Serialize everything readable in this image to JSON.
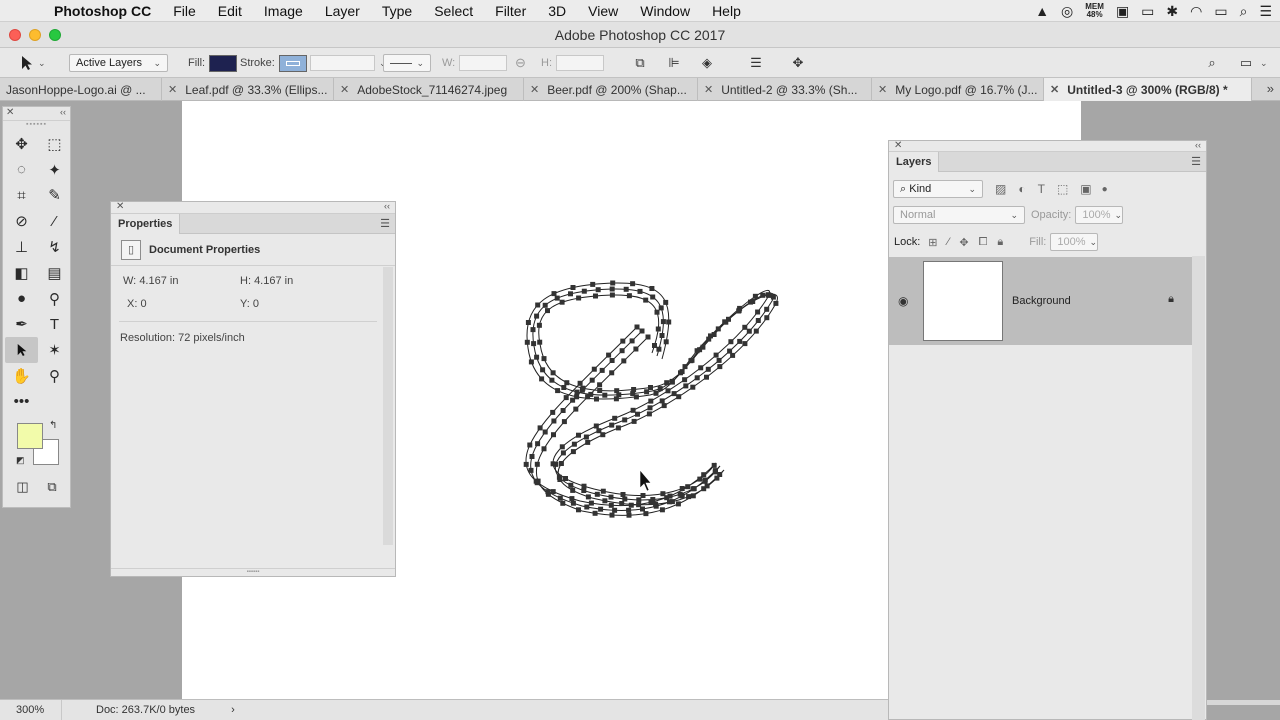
{
  "menubar": {
    "app_name": "Photoshop CC",
    "items": [
      "File",
      "Edit",
      "Image",
      "Layer",
      "Type",
      "Select",
      "Filter",
      "3D",
      "View",
      "Window",
      "Help"
    ],
    "mem_label": "MEM",
    "mem_value": "48%"
  },
  "window": {
    "title": "Adobe Photoshop CC 2017"
  },
  "options": {
    "auto_select": "Active Layers",
    "fill_label": "Fill:",
    "fill_color": "#1e2250",
    "stroke_label": "Stroke:",
    "stroke_color": "#8fb1d9",
    "w_label": "W:",
    "h_label": "H:"
  },
  "tabs": [
    {
      "label": "JasonHoppe-Logo.ai @ ...",
      "active": false
    },
    {
      "label": "Leaf.pdf @ 33.3% (Ellips...",
      "active": false
    },
    {
      "label": "AdobeStock_71146274.jpeg",
      "active": false
    },
    {
      "label": "Beer.pdf @ 200% (Shap...",
      "active": false
    },
    {
      "label": "Untitled-2 @ 33.3% (Sh...",
      "active": false
    },
    {
      "label": "My Logo.pdf @ 16.7% (J...",
      "active": false
    },
    {
      "label": "Untitled-3 @ 300% (RGB/8) *",
      "active": true
    }
  ],
  "toolbox": {
    "foreground_color": "#f2fbaa",
    "background_color": "#ffffff"
  },
  "properties": {
    "tab_label": "Properties",
    "section_title": "Document Properties",
    "w_label": "W:",
    "w_value": "4.167 in",
    "h_label": "H:",
    "h_value": "4.167 in",
    "x_label": "X:",
    "x_value": "0",
    "y_label": "Y:",
    "y_value": "0",
    "resolution": "Resolution: 72 pixels/inch"
  },
  "layers": {
    "tab_label": "Layers",
    "filter_kind": "Kind",
    "blend_mode": "Normal",
    "opacity_label": "Opacity:",
    "opacity_value": "100%",
    "lock_label": "Lock:",
    "fill_label": "Fill:",
    "fill_value": "100%",
    "items": [
      {
        "name": "Background",
        "visible": true,
        "locked": true
      }
    ]
  },
  "status": {
    "zoom": "300%",
    "doc_size": "Doc: 263.7K/0 bytes"
  }
}
